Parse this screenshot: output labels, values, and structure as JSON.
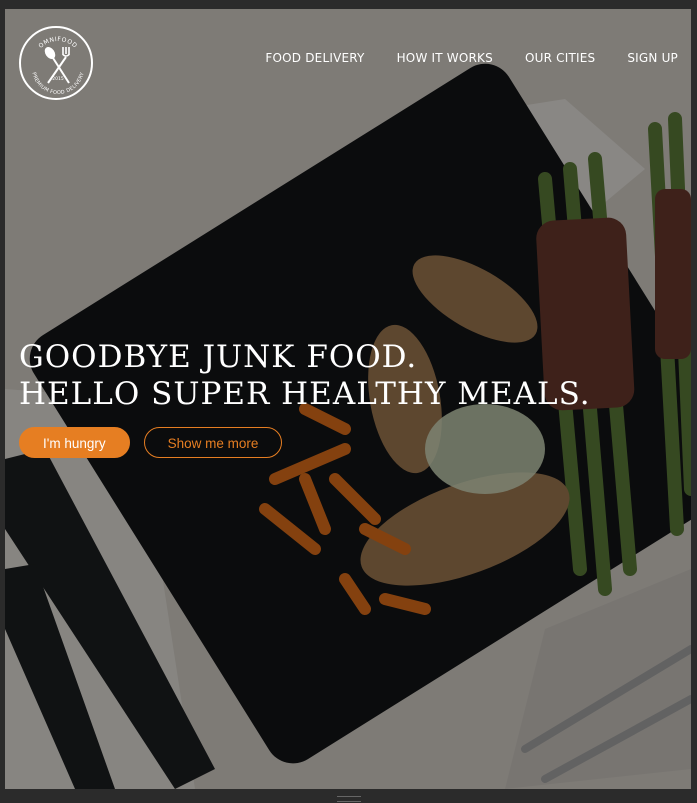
{
  "brand": {
    "top_text": "OMNIFOOD",
    "bottom_text": "PREMIUM FOOD DELIVERY",
    "est": "2015"
  },
  "nav": {
    "items": [
      "FOOD DELIVERY",
      "HOW IT WORKS",
      "OUR CITIES",
      "SIGN UP"
    ]
  },
  "hero": {
    "line1": "GOODBYE JUNK FOOD.",
    "line2": "HELLO SUPER HEALTHY MEALS.",
    "primary_button": "I'm hungry",
    "secondary_button": "Show me more"
  },
  "colors": {
    "accent": "#e67e22",
    "text": "#ffffff",
    "overlay": "rgba(0,0,0,0.42)"
  },
  "icons": [
    "spoon-icon",
    "fork-icon"
  ]
}
